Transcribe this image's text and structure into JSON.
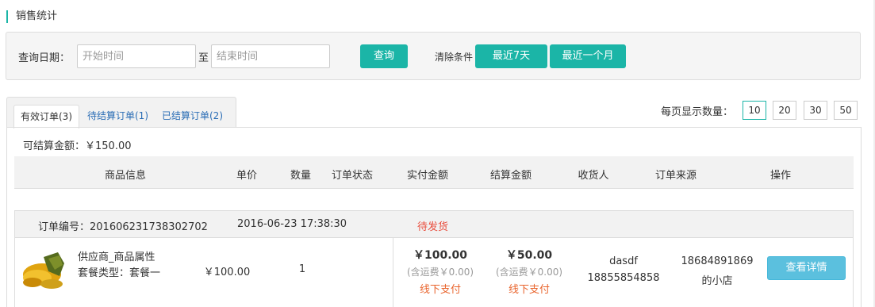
{
  "page": {
    "title": "销售统计"
  },
  "filter": {
    "date_label": "查询日期：",
    "start_placeholder": "开始时间",
    "to_label": "至",
    "end_placeholder": "结束时间",
    "query_label": "查询",
    "clear_label": "清除条件",
    "last7_label": "最近7天",
    "last_month_label": "最近一个月"
  },
  "tabs": [
    {
      "label": "有效订单(3)",
      "active": true
    },
    {
      "label": "待结算订单(1)",
      "active": false
    },
    {
      "label": "已结算订单(2)",
      "active": false
    }
  ],
  "per_page": {
    "label": "每页显示数量：",
    "options": [
      "10",
      "20",
      "30",
      "50"
    ],
    "selected": "10"
  },
  "summary": {
    "settle_label": "可结算金额：￥150.00"
  },
  "columns": [
    "商品信息",
    "单价",
    "数量",
    "订单状态",
    "实付金额",
    "结算金额",
    "收货人",
    "订单来源",
    "操作"
  ],
  "order": {
    "number_label": "订单编号：201606231738302702",
    "datetime": "2016-06-23 17:38:30",
    "status": "待发货",
    "product_name": "供应商_商品属性",
    "product_attr": "套餐类型：套餐一",
    "unit_price": "￥100.00",
    "quantity": "1",
    "paid_amount": "￥100.00",
    "paid_fee": "(含运费￥0.00)",
    "paid_method": "线下支付",
    "settle_amount": "￥50.00",
    "settle_fee": "(含运费￥0.00)",
    "settle_method": "线下支付",
    "receiver_name": "dasdf",
    "receiver_phone": "18855854858",
    "source_line1": "18684891869",
    "source_line2": "的小店",
    "detail_label": "查看详情"
  },
  "colors": {
    "accent": "#1bb5a7",
    "link": "#2a6db5",
    "status_red": "#e94e3e",
    "pay_orange": "#e9652e",
    "detail_blue": "#5bc0de"
  }
}
